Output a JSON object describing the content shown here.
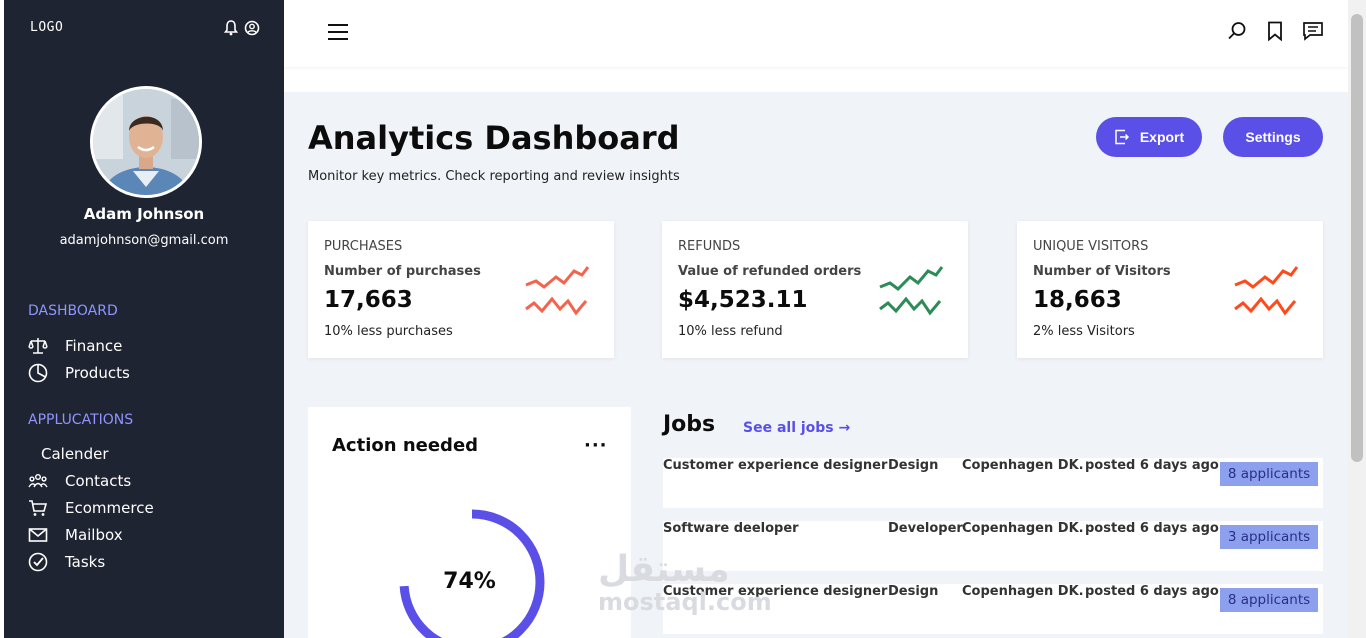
{
  "sidebar": {
    "logo": "LOGO",
    "user": {
      "name": "Adam Johnson",
      "email": "adamjohnson@gmail.com"
    },
    "dashboard_title": "DASHBOARD",
    "dashboard_items": [
      {
        "label": "Finance",
        "icon": "scale-icon"
      },
      {
        "label": "Products",
        "icon": "pie-chart-icon"
      }
    ],
    "applications_title": "APPLUCATIONS",
    "application_items": [
      {
        "label": "Calender",
        "icon": ""
      },
      {
        "label": "Contacts",
        "icon": "contacts-icon"
      },
      {
        "label": "Ecommerce",
        "icon": "cart-icon"
      },
      {
        "label": "Mailbox",
        "icon": "mail-icon"
      },
      {
        "label": "Tasks",
        "icon": "check-circle-icon"
      }
    ]
  },
  "header": {
    "title": "Analytics Dashboard",
    "subtitle": "Monitor key metrics. Check reporting and review insights",
    "export_label": "Export",
    "settings_label": "Settings"
  },
  "stats": [
    {
      "label": "PURCHASES",
      "desc": "Number of purchases",
      "value": "17,663",
      "foot": "10% less purchases",
      "color": "#f2644e"
    },
    {
      "label": "REFUNDS",
      "desc": "Value of refunded orders",
      "value": "$4,523.11",
      "foot": "10% less refund",
      "color": "#2e8b57"
    },
    {
      "label": "UNIQUE VISITORS",
      "desc": "Number of Visitors",
      "value": "18,663",
      "foot": "2% less Visitors",
      "color": "#ff4a1c"
    }
  ],
  "action": {
    "title": "Action needed",
    "more": "···",
    "value": "74%",
    "fraction": 0.74,
    "color": "#5a4fe7"
  },
  "jobs": {
    "title": "Jobs",
    "see_all": "See all jobs →",
    "rows": [
      {
        "title": "Customer experience designer",
        "category": "Design",
        "location": "Copenhagen DK.",
        "posted": "posted 6 days ago",
        "applicants": "8 applicants"
      },
      {
        "title": "Software deeloper",
        "category": "Developer",
        "location": "Copenhagen DK.",
        "posted": "posted 6 days ago",
        "applicants": "3 applicants"
      },
      {
        "title": "Customer experience designer",
        "category": "Design",
        "location": "Copenhagen DK.",
        "posted": "posted 6 days ago",
        "applicants": "8 applicants"
      }
    ]
  },
  "watermark": {
    "arabic": "مستقل",
    "latin": "mostaql.com"
  }
}
